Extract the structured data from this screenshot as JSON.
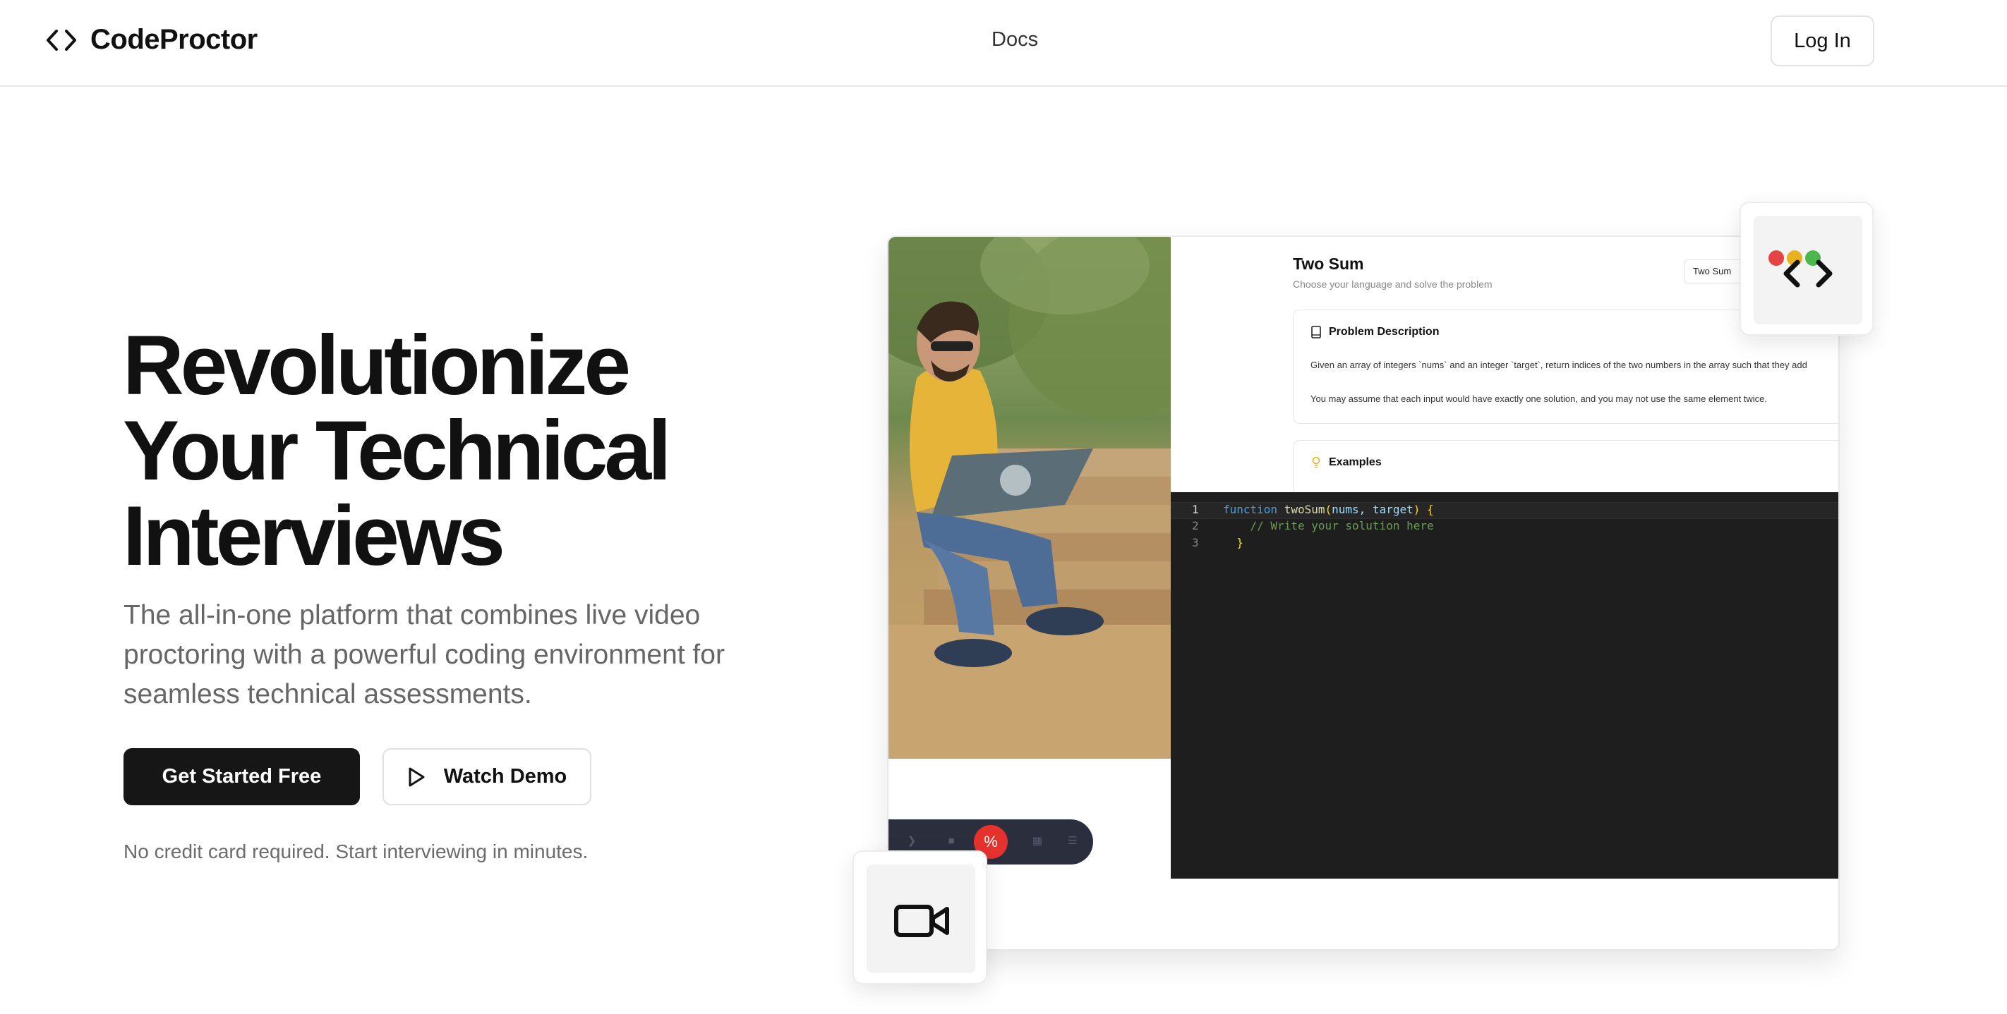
{
  "brand": {
    "name": "CodeProctor",
    "icon": "code-brackets-icon"
  },
  "nav": {
    "docs_label": "Docs",
    "login_label": "Log In"
  },
  "hero": {
    "title_lines": [
      "Revolutionize",
      "Your Technical",
      "Interviews"
    ],
    "subtitle": "The all-in-one platform that combines live video proctoring with a powerful coding environment for seamless technical assessments.",
    "primary_cta": "Get Started Free",
    "secondary_cta": "Watch Demo",
    "secondary_icon": "play-icon",
    "note": "No credit card required. Start interviewing in minutes."
  },
  "mockup": {
    "problem": {
      "title": "Two Sum",
      "subtitle": "Choose your language and solve the problem",
      "language_value": "Two Sum",
      "description_heading": "Problem Description",
      "description_p1": "Given an array of integers `nums` and an integer `target`, return indices of the two numbers in the array such that they add",
      "description_p2": "You may assume that each input would have exactly one solution, and you may not use the same element twice.",
      "examples_heading": "Examples"
    },
    "editor": {
      "lines": [
        {
          "num": "1",
          "keyword": "function",
          "fn": "twoSum",
          "open": "(",
          "params": "nums, target",
          "close": ")",
          "brace": "{"
        },
        {
          "num": "2",
          "comment": "// Write your solution here"
        },
        {
          "num": "3",
          "brace": "}"
        }
      ]
    },
    "controls": {
      "end_call_icon": "end-call-icon",
      "end_call_glyph": "%"
    }
  },
  "colors": {
    "primary": "#161616",
    "end_call": "#e5322d",
    "editor_bg": "#1e1e1e",
    "traffic_red": "#e54444",
    "traffic_yellow": "#e8b21e",
    "traffic_green": "#4cb84c"
  }
}
